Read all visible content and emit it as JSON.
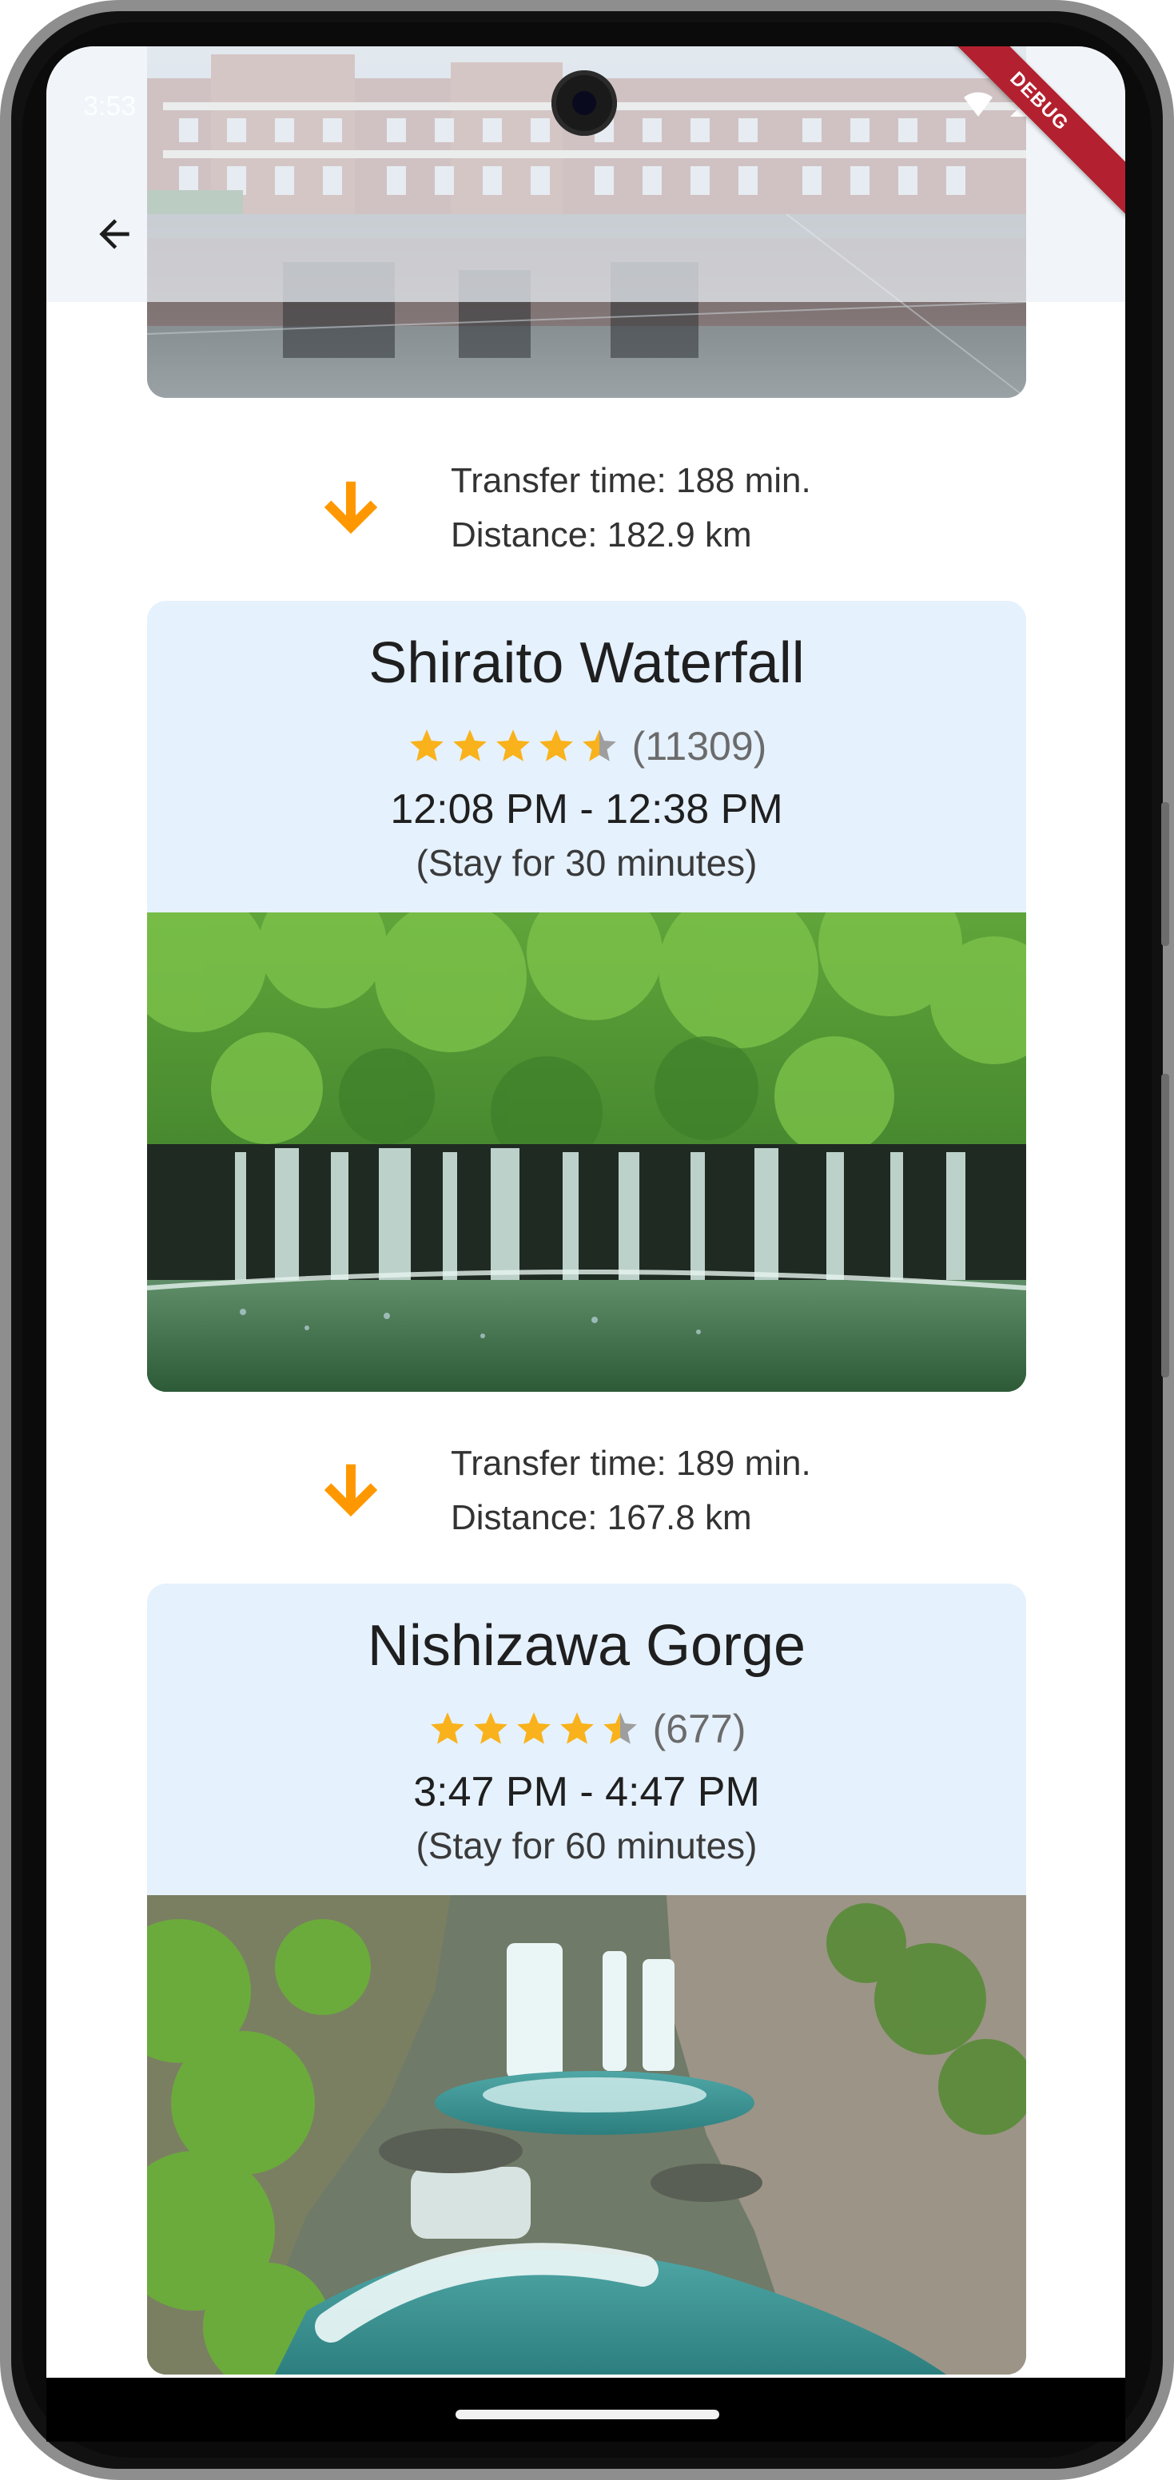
{
  "status_bar": {
    "time": "3:53"
  },
  "debug_label": "DEBUG",
  "transfers": [
    {
      "time": "Transfer time: 188 min.",
      "distance": "Distance: 182.9 km"
    },
    {
      "time": "Transfer time: 189 min.",
      "distance": "Distance: 167.8 km"
    }
  ],
  "spots": [
    {
      "name": "Shiraito Waterfall",
      "rating": 4.5,
      "reviews": "(11309)",
      "time_range": "12:08 PM - 12:38 PM",
      "stay": "(Stay for 30 minutes)"
    },
    {
      "name": "Nishizawa Gorge",
      "rating": 4.5,
      "reviews": "(677)",
      "time_range": "3:47 PM - 4:47 PM",
      "stay": "(Stay for 60 minutes)"
    }
  ],
  "colors": {
    "accent_arrow": "#FF9800",
    "star": "#F9B21B",
    "card_bg": "#E5F1FD"
  }
}
